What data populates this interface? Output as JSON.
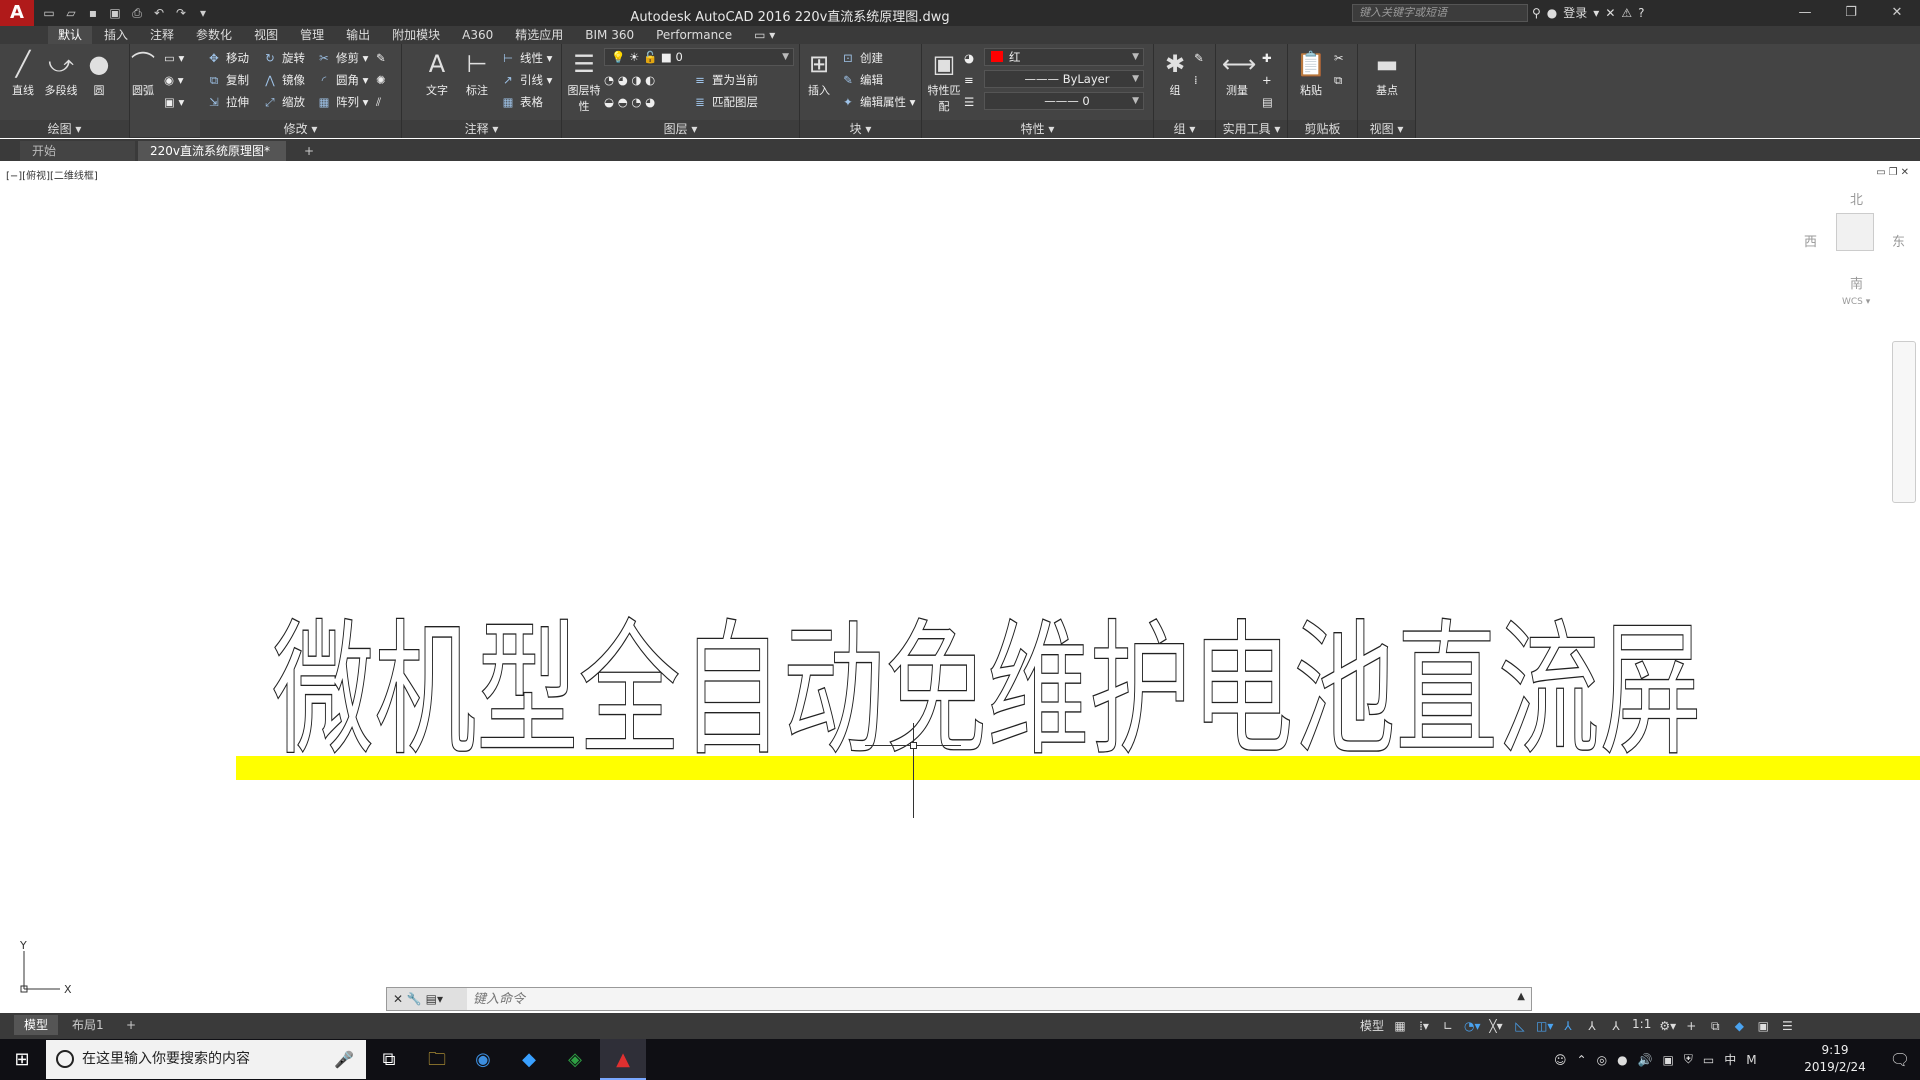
{
  "app": {
    "logo": "A",
    "title": "Autodesk AutoCAD 2016    220v直流系统原理图.dwg",
    "search_placeholder": "键入关键字或短语",
    "login_label": "登录"
  },
  "quick_access": [
    "new-icon",
    "open-icon",
    "save-icon",
    "saveas-icon",
    "print-icon",
    "undo-icon",
    "redo-icon"
  ],
  "ribbon_tabs": [
    "默认",
    "插入",
    "注释",
    "参数化",
    "视图",
    "管理",
    "输出",
    "附加模块",
    "A360",
    "精选应用",
    "BIM 360",
    "Performance"
  ],
  "ribbon": {
    "draw": {
      "title": "绘图 ▾",
      "line": "直线",
      "polyline": "多段线",
      "circle": "圆",
      "arc": "圆弧"
    },
    "modify": {
      "title": "修改 ▾",
      "move": "移动",
      "rotate": "旋转",
      "trim": "修剪",
      "copy": "复制",
      "mirror": "镜像",
      "fillet": "圆角",
      "stretch": "拉伸",
      "scale": "缩放",
      "array": "阵列"
    },
    "annotation": {
      "title": "注释 ▾",
      "text": "文字",
      "dimension": "标注",
      "linear": "线性",
      "leader": "引线",
      "table": "表格"
    },
    "layers": {
      "title": "图层 ▾",
      "properties": "图层特性",
      "current_layer": "0",
      "set_current": "置为当前",
      "match_layer": "匹配图层"
    },
    "block": {
      "title": "块 ▾",
      "insert": "插入",
      "create": "创建",
      "edit": "编辑",
      "edit_attr": "编辑属性"
    },
    "properties": {
      "title": "特性 ▾",
      "match": "特性匹配",
      "color": "红",
      "linetype": "ByLayer",
      "lineweight": "0"
    },
    "groups": {
      "title": "组 ▾",
      "group": "组"
    },
    "utilities": {
      "title": "实用工具 ▾",
      "measure": "测量"
    },
    "clipboard": {
      "title": "剪贴板",
      "paste": "粘贴"
    },
    "view": {
      "title": "视图 ▾",
      "base": "基点"
    }
  },
  "doc_tabs": {
    "start": "开始",
    "file": "220v直流系统原理图*",
    "add": "+"
  },
  "canvas": {
    "viewport_label": "[−][俯视][二维线框]",
    "drawing_text": "微机型全自动免维护电池直流屏",
    "viewcube": {
      "north": "北",
      "south": "南",
      "east": "东",
      "west": "西",
      "wcs": "WCS ▾"
    },
    "ucs": {
      "x": "X",
      "y": "Y"
    }
  },
  "command": {
    "placeholder": "键入命令"
  },
  "status": {
    "model_tab": "模型",
    "layout_tab": "布局1",
    "add": "+",
    "model": "模型",
    "scale": "1:1"
  },
  "taskbar": {
    "search_text": "在这里输入你要搜索的内容",
    "time": "9:19",
    "date": "2019/2/24",
    "ime": "中"
  },
  "colors": {
    "accent_red": "#b01a1a",
    "highlight_yellow": "#ffff00",
    "ribbon_bg": "#444444",
    "status_blue": "#4aa3f0"
  }
}
